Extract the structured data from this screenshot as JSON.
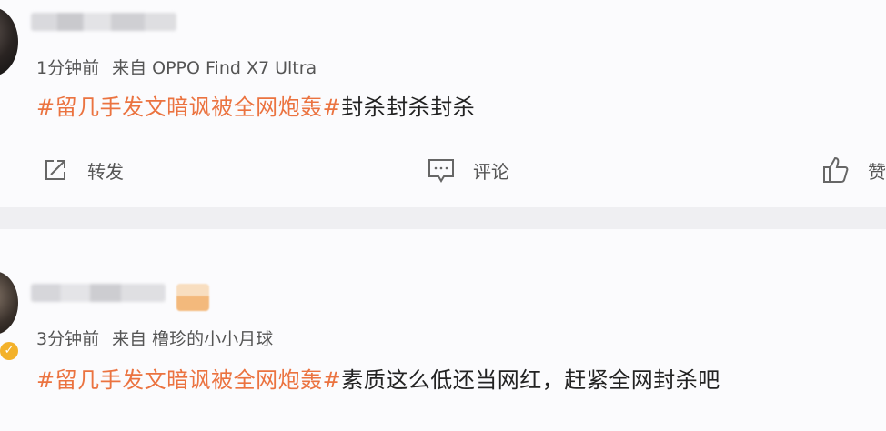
{
  "posts": [
    {
      "time": "1分钟前",
      "source": "来自 OPPO Find X7 Ultra",
      "hashtag": "#留几手发文暗讽被全网炮轰#",
      "text": "封杀封杀封杀",
      "actions": {
        "repost": "转发",
        "comment": "评论",
        "like": "赞"
      }
    },
    {
      "time": "3分钟前",
      "source": "来自 橹珍的小小月球",
      "hashtag": "#留几手发文暗讽被全网炮轰#",
      "text": "素质这么低还当网红，赶紧全网封杀吧"
    }
  ],
  "colors": {
    "hashtag": "#eb7340",
    "vip_badge": "#f3b12a"
  },
  "icons": [
    "repost-icon",
    "comment-icon",
    "like-icon",
    "vip-badge-icon"
  ]
}
